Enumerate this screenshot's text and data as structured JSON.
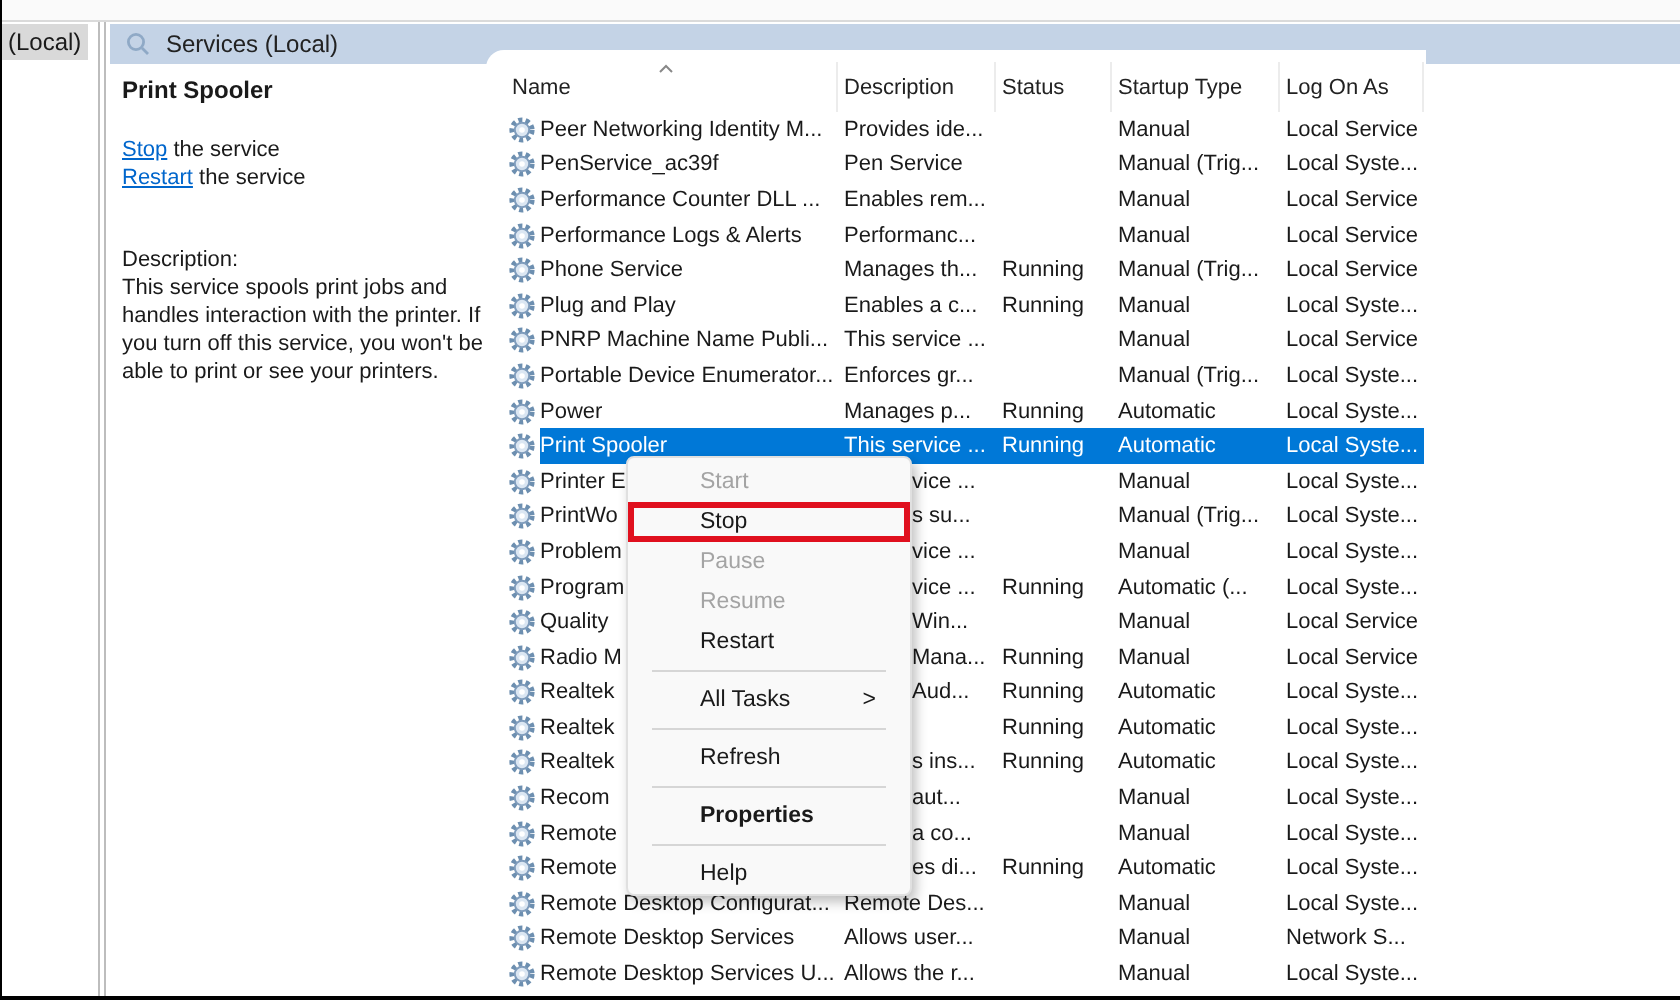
{
  "tree": {
    "item": "(Local)",
    "selected": true
  },
  "header": {
    "title": "Services (Local)"
  },
  "details": {
    "title": "Print Spooler",
    "actions": [
      {
        "link": "Stop",
        "text": "the service"
      },
      {
        "link": "Restart",
        "text": "the service"
      }
    ],
    "description_label": "Description:",
    "description": "This service spools print jobs and handles interaction with the printer. If you turn off this service, you won't be able to print or see your printers."
  },
  "table": {
    "columns": [
      "Name",
      "Description",
      "Status",
      "Startup Type",
      "Log On As"
    ],
    "rows": [
      {
        "name": "Peer Networking Identity M...",
        "description": "Provides ide...",
        "startup": "Manual",
        "logon": "Local Service",
        "selected": false,
        "covered": false
      },
      {
        "name": "PenService_ac39f",
        "description": "Pen Service",
        "startup": "Manual (Trig...",
        "logon": "Local Syste...",
        "selected": false,
        "covered": false
      },
      {
        "name": "Performance Counter DLL ...",
        "description": "Enables rem...",
        "startup": "Manual",
        "logon": "Local Service",
        "selected": false,
        "covered": false
      },
      {
        "name": "Performance Logs & Alerts",
        "description": "Performanc...",
        "startup": "Manual",
        "logon": "Local Service",
        "selected": false,
        "covered": false
      },
      {
        "name": "Phone Service",
        "description": "Manages th...",
        "status": "Running",
        "startup": "Manual (Trig...",
        "logon": "Local Service",
        "selected": false,
        "covered": false
      },
      {
        "name": "Plug and Play",
        "description": "Enables a c...",
        "status": "Running",
        "startup": "Manual",
        "logon": "Local Syste...",
        "selected": false,
        "covered": false
      },
      {
        "name": "PNRP Machine Name Publi...",
        "description": "This service ...",
        "startup": "Manual",
        "logon": "Local Service",
        "selected": false,
        "covered": false
      },
      {
        "name": "Portable Device Enumerator...",
        "description": "Enforces gr...",
        "startup": "Manual (Trig...",
        "logon": "Local Syste...",
        "selected": false,
        "covered": false
      },
      {
        "name": "Power",
        "description": "Manages p...",
        "status": "Running",
        "startup": "Automatic",
        "logon": "Local Syste...",
        "selected": false,
        "covered": false
      },
      {
        "name": "Print Spooler",
        "description": "This service ...",
        "status": "Running",
        "startup": "Automatic",
        "logon": "Local Syste...",
        "selected": true,
        "covered": false
      },
      {
        "name": "Printer E",
        "description": "vice ...",
        "startup": "Manual",
        "logon": "Local Syste...",
        "selected": false,
        "covered": true
      },
      {
        "name": "PrintWo",
        "description": "s su...",
        "startup": "Manual (Trig...",
        "logon": "Local Syste...",
        "selected": false,
        "covered": true
      },
      {
        "name": "Problem",
        "description": "vice ...",
        "startup": "Manual",
        "logon": "Local Syste...",
        "selected": false,
        "covered": true
      },
      {
        "name": "Program",
        "description": "vice ...",
        "status": "Running",
        "startup": "Automatic (...",
        "logon": "Local Syste...",
        "selected": false,
        "covered": true
      },
      {
        "name": "Quality",
        "description": "Win...",
        "startup": "Manual",
        "logon": "Local Service",
        "selected": false,
        "covered": true
      },
      {
        "name": "Radio M",
        "description": "Mana...",
        "status": "Running",
        "startup": "Manual",
        "logon": "Local Service",
        "selected": false,
        "covered": true
      },
      {
        "name": "Realtek",
        "description": "Aud...",
        "status": "Running",
        "startup": "Automatic",
        "logon": "Local Syste...",
        "selected": false,
        "covered": true
      },
      {
        "name": "Realtek",
        "status": "Running",
        "startup": "Automatic",
        "logon": "Local Syste...",
        "selected": false
      },
      {
        "name": "Realtek",
        "description": "s ins...",
        "status": "Running",
        "startup": "Automatic",
        "logon": "Local Syste...",
        "selected": false,
        "covered": true
      },
      {
        "name": "Recom",
        "description": "aut...",
        "startup": "Manual",
        "logon": "Local Syste...",
        "selected": false,
        "covered": true
      },
      {
        "name": "Remote",
        "description": "a co...",
        "startup": "Manual",
        "logon": "Local Syste...",
        "selected": false,
        "covered": true
      },
      {
        "name": "Remote",
        "description": "es di...",
        "status": "Running",
        "startup": "Automatic",
        "logon": "Local Syste...",
        "selected": false,
        "covered": true
      },
      {
        "name": "Remote Desktop Configurat...",
        "description": "Remote Des...",
        "startup": "Manual",
        "logon": "Local Syste...",
        "selected": false,
        "covered": false
      },
      {
        "name": "Remote Desktop Services",
        "description": "Allows user...",
        "startup": "Manual",
        "logon": "Network S...",
        "selected": false,
        "covered": false
      },
      {
        "name": "Remote Desktop Services U...",
        "description": "Allows the r...",
        "startup": "Manual",
        "logon": "Local Syste...",
        "selected": false,
        "covered": false
      }
    ]
  },
  "context_menu": {
    "items": [
      {
        "kind": "item",
        "label": "Start",
        "disabled": true,
        "highlighted": false,
        "bold": false
      },
      {
        "kind": "item",
        "label": "Stop",
        "disabled": false,
        "highlighted": true,
        "bold": false
      },
      {
        "kind": "item",
        "label": "Pause",
        "disabled": true,
        "highlighted": false,
        "bold": false
      },
      {
        "kind": "item",
        "label": "Resume",
        "disabled": true,
        "highlighted": false,
        "bold": false
      },
      {
        "kind": "item",
        "label": "Restart",
        "disabled": false,
        "highlighted": false,
        "bold": false
      },
      {
        "kind": "separator"
      },
      {
        "kind": "submenu",
        "label": "All Tasks",
        "arrow": ">",
        "disabled": false,
        "highlighted": false,
        "bold": false
      },
      {
        "kind": "separator"
      },
      {
        "kind": "item",
        "label": "Refresh",
        "disabled": false,
        "highlighted": false,
        "bold": false
      },
      {
        "kind": "separator"
      },
      {
        "kind": "item",
        "label": "Properties",
        "disabled": false,
        "highlighted": false,
        "bold": true
      },
      {
        "kind": "separator"
      },
      {
        "kind": "item",
        "label": "Help",
        "disabled": false,
        "highlighted": false,
        "bold": false
      }
    ]
  }
}
